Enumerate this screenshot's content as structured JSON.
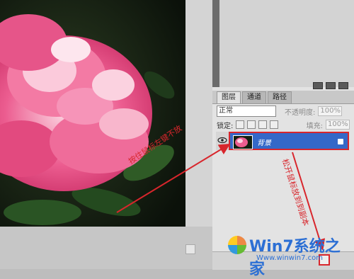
{
  "layers_panel": {
    "tabs": [
      {
        "label": "图层",
        "active": true
      },
      {
        "label": "通道",
        "active": false
      },
      {
        "label": "路径",
        "active": false
      }
    ],
    "blend_mode": "正常",
    "opacity_label": "不透明度:",
    "opacity_value": "100%",
    "lock_label": "锁定:",
    "fill_label": "填充:",
    "fill_value": "100%",
    "layer": {
      "name": "背景",
      "selected": true
    }
  },
  "annotations": {
    "left_text": "按住鼠标左键不放",
    "right_text": "松开鼠标放到到副本"
  },
  "watermark": {
    "brand": "Win7系统之家",
    "url": "Www.winwin7.com"
  },
  "colors": {
    "annotation_red": "#d8262c",
    "layer_selected_blue": "#3468c8",
    "panel_gray": "#e3e3e3",
    "watermark_blue": "#2c6fd4"
  },
  "icons": [
    "eye-icon",
    "lock-icon",
    "new-layer-icon",
    "win-logo-icon"
  ]
}
